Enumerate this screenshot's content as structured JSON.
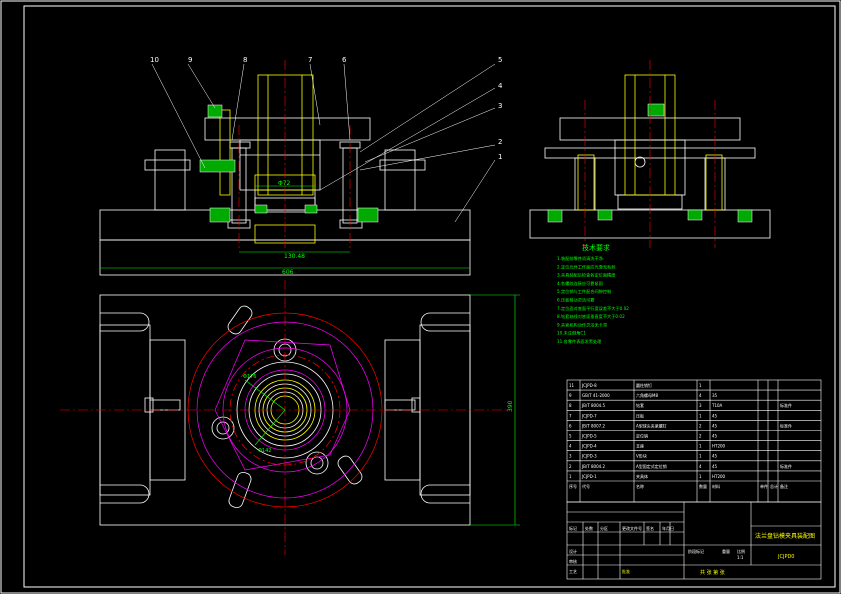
{
  "balloons": [
    "10",
    "9",
    "8",
    "7",
    "6",
    "5",
    "4",
    "3",
    "2",
    "1"
  ],
  "dimensions": {
    "base_length": "606",
    "pin_spacing": "130.48",
    "base_width": "390",
    "cyl_dim": "Φ72",
    "pcd_a": "Φ176",
    "pcd_b": "Φ142"
  },
  "tech_notes": {
    "title": "技术要求",
    "lines": [
      "1.装配前零件须清洗干净",
      "2.定位元件工作面应光滑无毛刺",
      "3.夹具装配后检查各定位面精度",
      "4.各螺纹连接应可靠紧固",
      "5.定位销与工件配合间隙控制",
      "6.压板移动灵活可靠",
      "7.定位面对底面平行度误差不大于0.02",
      "8.钻套轴线对底面垂直度不大于0.02",
      "9.夹紧机构动作灵活无卡滞",
      "10.未注倒角C1",
      "11.各零件表面发黑处理"
    ]
  },
  "bom": {
    "headers": [
      "序号",
      "代号",
      "名称",
      "数量",
      "材料",
      "单件",
      "总计",
      "备注"
    ],
    "rows": [
      [
        "11",
        "JCJPD-8",
        "圆柱销钉",
        "1",
        "",
        ""
      ],
      [
        "9",
        "GB/T 41-2000",
        "六角螺母M8",
        "4",
        "35",
        ""
      ],
      [
        "8",
        "JB/T 8004.5",
        "钻套",
        "3",
        "T10A",
        "标准件"
      ],
      [
        "7",
        "JCJPD-7",
        "压板",
        "1",
        "45",
        ""
      ],
      [
        "6",
        "JB/T 8007.2",
        "A型球头夹紧螺钉",
        "2",
        "45",
        "标准件"
      ],
      [
        "5",
        "JCJPD-5",
        "定位销",
        "2",
        "45",
        ""
      ],
      [
        "4",
        "JCJPD-4",
        "支座",
        "1",
        "HT200",
        ""
      ],
      [
        "3",
        "JCJPD-3",
        "V形块",
        "1",
        "45",
        ""
      ],
      [
        "2",
        "JB/T 8004.2",
        "A型固定式定位销",
        "4",
        "45",
        "标准件"
      ],
      [
        "1",
        "JCJPD-1",
        "夹具体",
        "1",
        "HT200",
        ""
      ]
    ]
  },
  "title_block": {
    "drawing_title": "法兰盘钻模夹具装配图",
    "drawing_code": "JCJPD0",
    "scale": "1:1",
    "sheet_label": "共 张 第 张",
    "cells": [
      "标记",
      "处数",
      "分区",
      "更改文件号",
      "签名",
      "年月日",
      "设计",
      "审核",
      "工艺",
      "批准",
      "阶段标记",
      "重量",
      "比例"
    ]
  },
  "colors": {
    "outline": "#ffffff",
    "hidden": "#ffff00",
    "center": "#ff0000",
    "dim": "#00ff00",
    "aux": "#ff00ff",
    "frame": "#ffffff"
  }
}
